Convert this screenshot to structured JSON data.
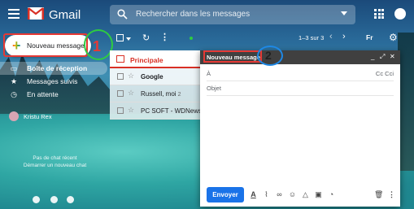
{
  "header": {
    "brand": "Gmail",
    "search_placeholder": "Rechercher dans les messages"
  },
  "compose_button": {
    "label": "Nouveau message"
  },
  "annotations": {
    "one": "1",
    "two": "2"
  },
  "sidebar": {
    "items": [
      {
        "label": "Boîte de réception",
        "icon": "inbox-icon",
        "active": true
      },
      {
        "label": "Messages suivis",
        "icon": "star-icon",
        "active": false
      },
      {
        "label": "En attente",
        "icon": "clock-icon",
        "active": false
      }
    ],
    "user": "Kristu Rex",
    "chat_empty_line1": "Pas de chat récent",
    "chat_empty_line2": "Démarrer un nouveau chat"
  },
  "toolbar": {
    "count": "1–3 sur 3",
    "lang": "Fr"
  },
  "email_list": {
    "tab_label": "Principale",
    "rows": [
      {
        "sender": "Google",
        "count": ""
      },
      {
        "sender": "Russell, moi",
        "count": "2"
      },
      {
        "sender": "PC SOFT - WDNews",
        "count": ""
      }
    ]
  },
  "compose": {
    "title": "Nouveau message",
    "to_label": "À",
    "cc_label": "Cc Cci",
    "subject_label": "Objet",
    "send_label": "Envoyer"
  },
  "colors": {
    "accent_red": "#d93025",
    "send_blue": "#1a73e8",
    "annotation_red": "#e53935",
    "annotation_green": "#2ecc40",
    "annotation_blue": "#1e88e5"
  }
}
